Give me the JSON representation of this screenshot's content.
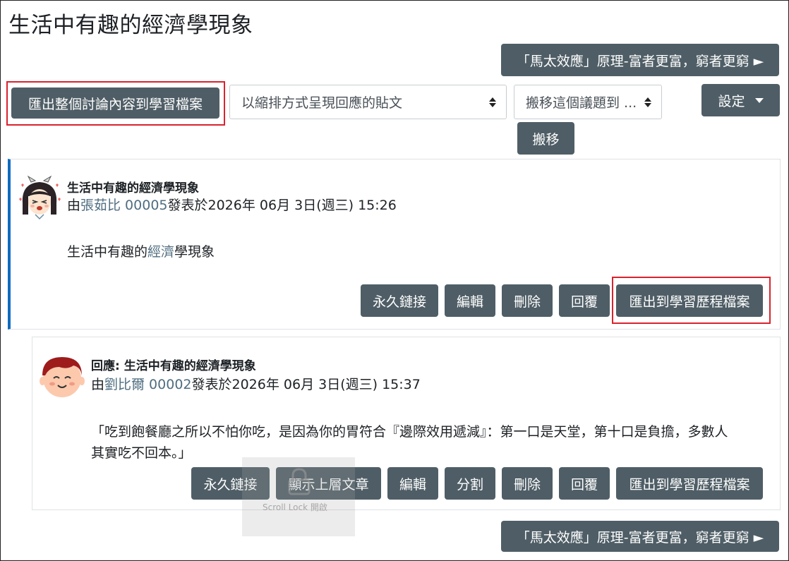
{
  "page": {
    "title": "生活中有趣的經濟學現象"
  },
  "nav": {
    "next_discussion": "「馬太效應」原理-富者更富，窮者更窮 ►"
  },
  "toolbar": {
    "export_all": "匯出整個討論內容到學習檔案",
    "display_mode": "以縮排方式呈現回應的貼文",
    "move_select": "搬移這個議題到 ...",
    "move_button": "搬移",
    "settings": "設定"
  },
  "posts": [
    {
      "subject": "生活中有趣的經濟學現象",
      "by": "由",
      "author": "張茹比 00005",
      "posted": "發表於2026年 06月 3日(週三) 15:26",
      "content_pre": "生活中有趣的",
      "content_link": "經濟",
      "content_post": "學現象",
      "actions": [
        "永久鏈接",
        "編輯",
        "刪除",
        "回覆",
        "匯出到學習歷程檔案"
      ]
    },
    {
      "subject": "回應: 生活中有趣的經濟學現象",
      "by": "由",
      "author": "劉比爾 00002",
      "posted": "發表於2026年 06月 3日(週三) 15:37",
      "content_line1": "「吃到飽餐廳之所以不怕你吃，是因為你的胃符合『邊際效用遞減』：第一口是天堂，第十口是負擔，多數人",
      "content_line2": "其實吃不回本。」",
      "actions": [
        "永久鏈接",
        "顯示上層文章",
        "編輯",
        "分割",
        "刪除",
        "回覆",
        "匯出到學習歷程檔案"
      ]
    }
  ],
  "overlay": {
    "scroll_lock": "Scroll Lock 開啟"
  },
  "colors": {
    "button_bg": "#4f5e66",
    "accent_border": "#0f6cbf",
    "highlight_box": "#d9232e",
    "link": "#4f6d80"
  }
}
